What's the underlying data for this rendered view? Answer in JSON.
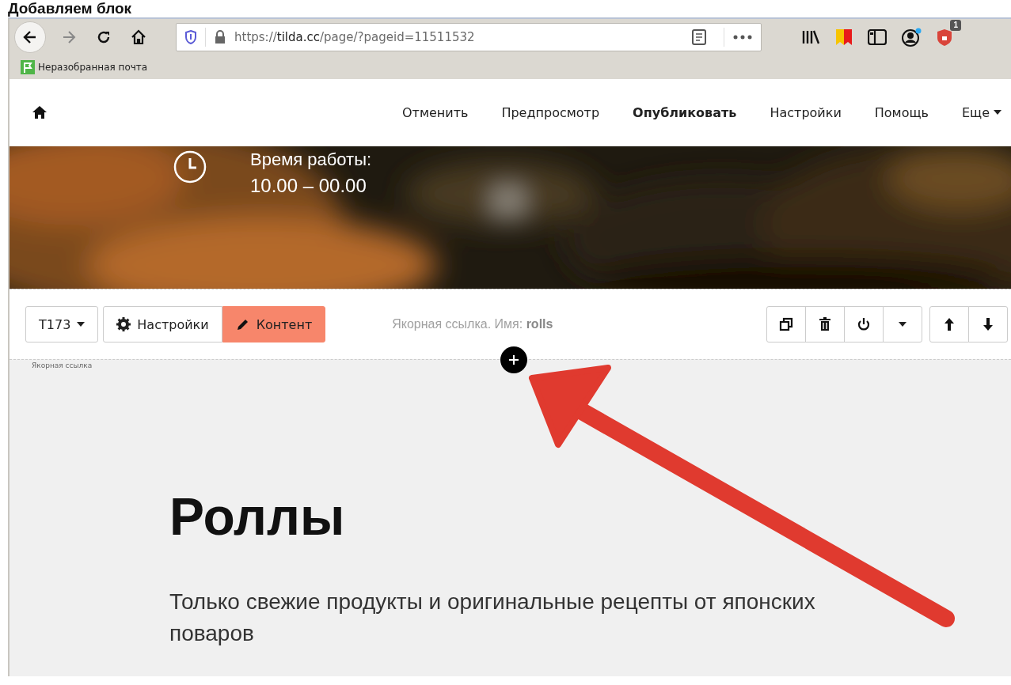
{
  "caption": "Добавляем блок",
  "browser": {
    "url_prefix": "https://",
    "url_host": "tilda.cc",
    "url_path": "/page/?pageid=11511532",
    "notification_badge": "1",
    "bookmarks": [
      {
        "label": "Неразобранная почта"
      }
    ]
  },
  "editor_nav": {
    "items": [
      {
        "label": "Отменить",
        "kind": "link"
      },
      {
        "label": "Предпросмотр",
        "kind": "link"
      },
      {
        "label": "Опубликовать",
        "kind": "primary"
      },
      {
        "label": "Настройки",
        "kind": "link"
      },
      {
        "label": "Помощь",
        "kind": "link"
      },
      {
        "label": "Еще",
        "kind": "dropdown"
      }
    ]
  },
  "hero": {
    "kind": "picture",
    "hours_label": "Время работы:",
    "hours": "10.00 – 00.00"
  },
  "block_toolbar": {
    "block_id": "T173",
    "tabs": [
      {
        "label": "Настройки",
        "selected": false
      },
      {
        "label": "Контент",
        "selected": true
      }
    ],
    "anchor_info": "Якорная ссылка. Имя: **rolls**",
    "anchor_tag": "Якорная ссылка"
  },
  "content": {
    "heading": "Роллы",
    "text": "Только свежие продукты и оригинальные рецепты от японских поваров"
  }
}
